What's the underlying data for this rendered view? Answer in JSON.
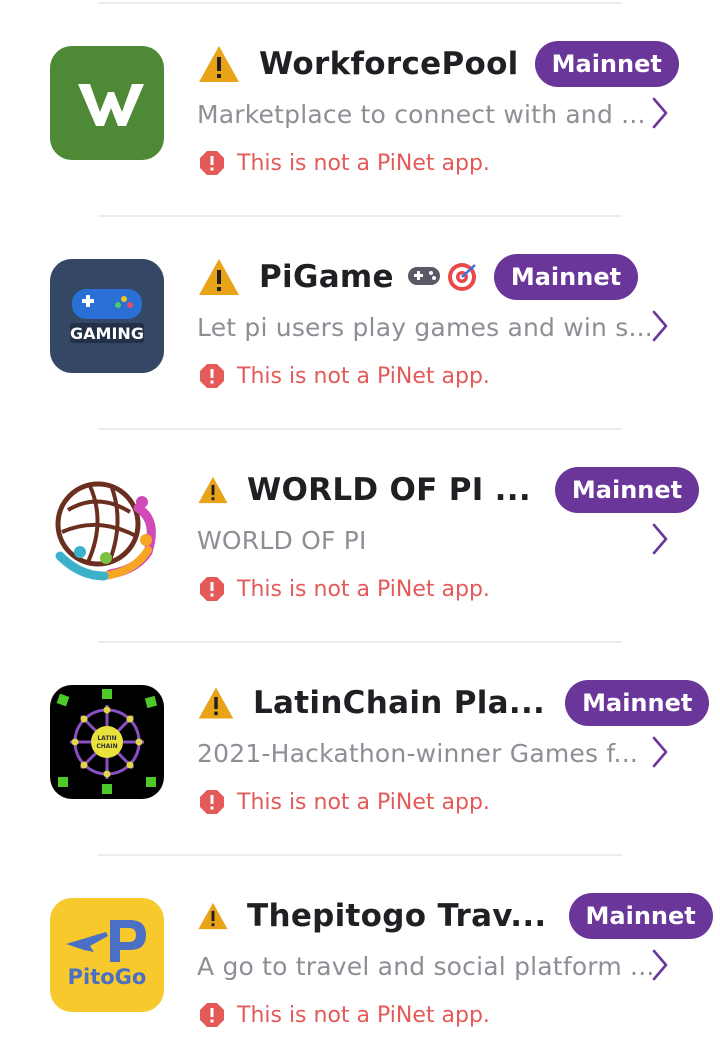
{
  "badge_label": "Mainnet",
  "not_pinet_notice": "This is not a PiNet app.",
  "colors": {
    "badge": "#6b3699",
    "warning": "#e8a317",
    "error": "#e35a58",
    "chevron": "#6b3699"
  },
  "apps": [
    {
      "name": "WorkforcePool",
      "description": "Marketplace to connect with and ...",
      "icon": "workforcepool-logo",
      "network": "Mainnet"
    },
    {
      "name": "PiGame",
      "title_emoji": [
        "game-controller-emoji",
        "direct-hit-emoji"
      ],
      "description": "Let pi users play games and win s...",
      "icon": "gaming-logo",
      "icon_text": "GAMING",
      "network": "Mainnet"
    },
    {
      "name": "WORLD OF PI ...",
      "description": "WORLD OF PI",
      "icon": "world-of-pi-logo",
      "network": "Mainnet"
    },
    {
      "name": "LatinChain Pla...",
      "description": "2021-Hackathon-winner Games f...",
      "icon": "latinchain-logo",
      "icon_text": "LATIN CHAIN",
      "network": "Mainnet"
    },
    {
      "name": "Thepitogo Trav...",
      "description": "A go to travel and social platform ...",
      "icon": "pitogo-logo",
      "icon_text": "PitoGo",
      "network": "Mainnet"
    }
  ]
}
